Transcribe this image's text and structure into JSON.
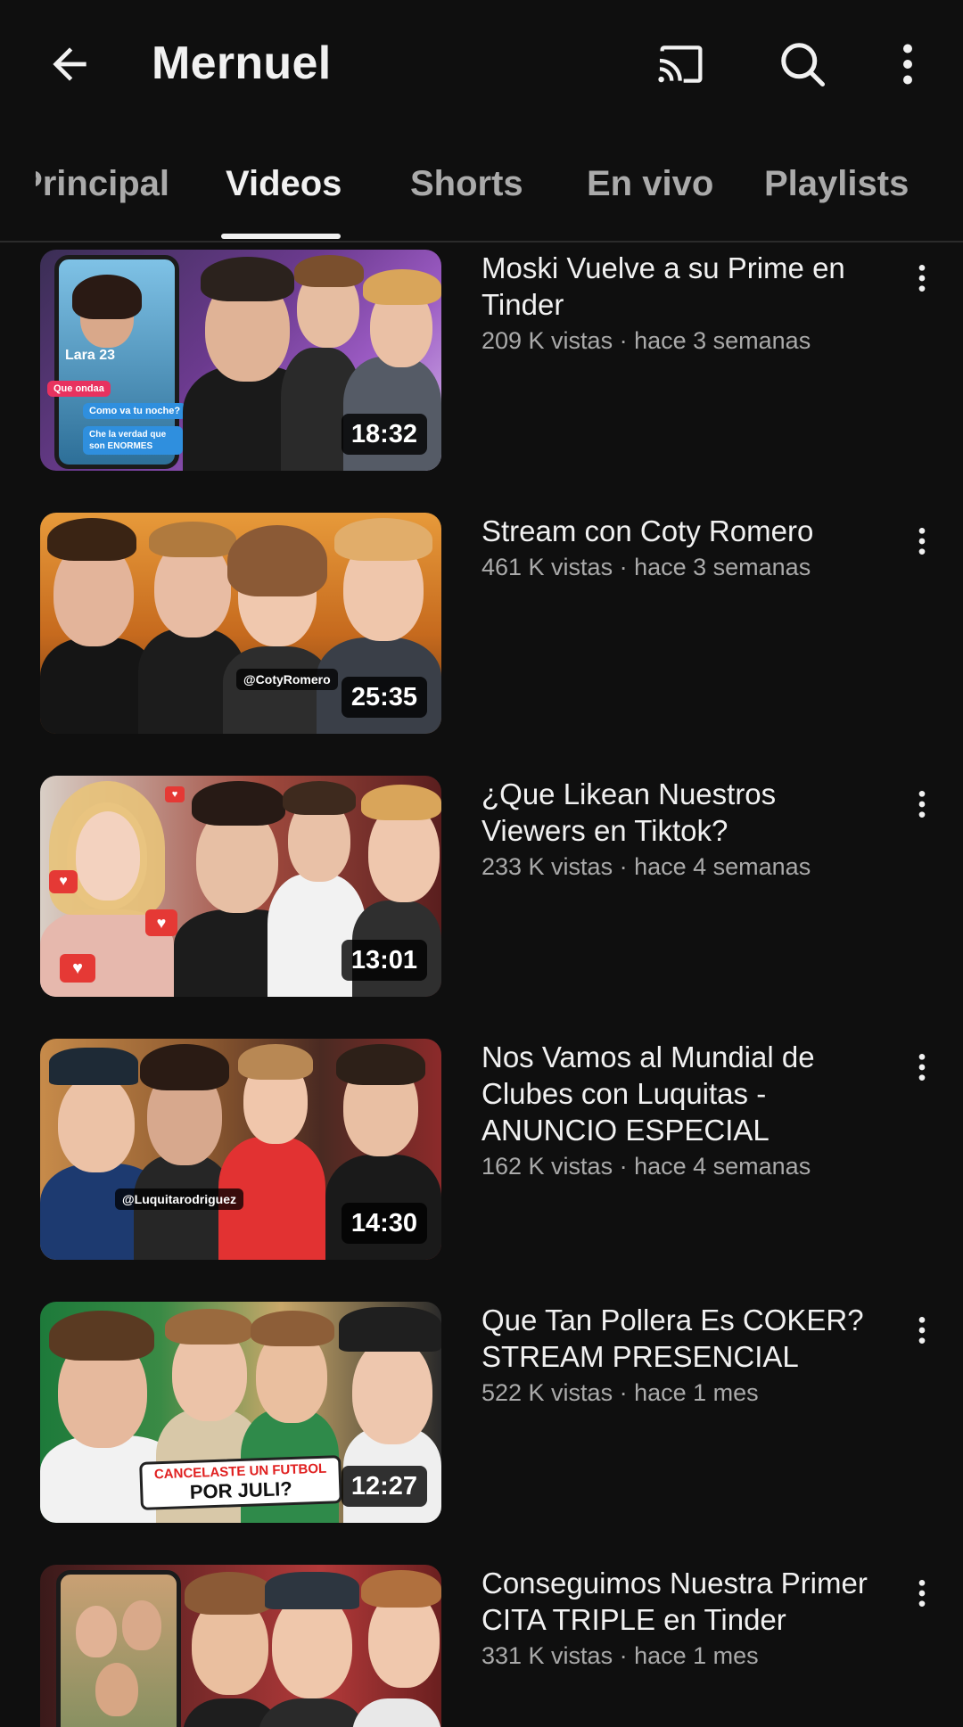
{
  "header": {
    "title": "Mernuel"
  },
  "tabs": [
    {
      "label": "Principal",
      "active": false
    },
    {
      "label": "Videos",
      "active": true
    },
    {
      "label": "Shorts",
      "active": false
    },
    {
      "label": "En vivo",
      "active": false
    },
    {
      "label": "Playlists",
      "active": false
    }
  ],
  "icons": {
    "back": "back-arrow-icon",
    "cast": "cast-icon",
    "search": "search-icon",
    "more": "more-vert-icon"
  },
  "colors": {
    "background": "#0f0f0f",
    "text_primary": "#f1f1f1",
    "text_secondary": "#aaaaaa"
  },
  "videos": [
    {
      "title": "Moski Vuelve a su Prime en Tinder",
      "meta": "209 K vistas · hace 3 semanas",
      "duration": "18:32",
      "thumb_text": [
        "Lara 23",
        "Que ondaa",
        "Como va tu noche?",
        "Che la verdad que son ENORMES"
      ]
    },
    {
      "title": "Stream con Coty Romero",
      "meta": "461 K vistas · hace 3 semanas",
      "duration": "25:35",
      "thumb_text": [
        "@CotyRomero"
      ]
    },
    {
      "title": "¿Que Likean Nuestros Viewers en Tiktok?",
      "meta": "233 K vistas · hace 4 semanas",
      "duration": "13:01",
      "thumb_text": []
    },
    {
      "title": "Nos Vamos al Mundial de Clubes con Luquitas - ANUNCIO ESPECIAL",
      "meta": "162 K vistas · hace 4 semanas",
      "duration": "14:30",
      "thumb_text": [
        "@Luquitarodriguez"
      ]
    },
    {
      "title": "Que Tan Pollera Es COKER? STREAM PRESENCIAL",
      "meta": "522 K vistas · hace 1 mes",
      "duration": "12:27",
      "thumb_text": [
        "CANCELASTE UN FUTBOL",
        "POR JULI?"
      ]
    },
    {
      "title": "Conseguimos Nuestra Primer CITA TRIPLE en Tinder",
      "meta": "331 K vistas · hace 1 mes",
      "duration": "",
      "thumb_text": []
    }
  ]
}
